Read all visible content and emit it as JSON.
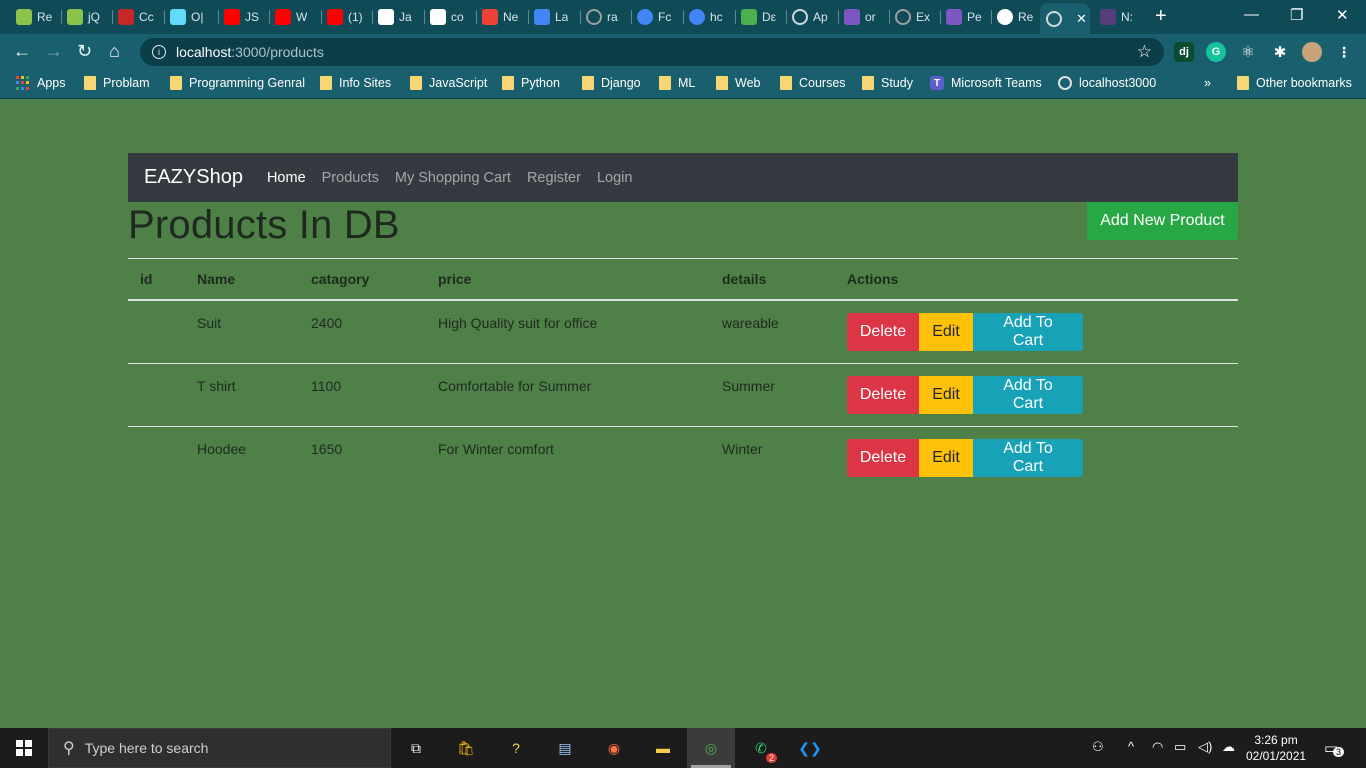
{
  "browser": {
    "tabs": [
      {
        "label": "Re",
        "icon": "green-chart-icon",
        "color": "#8bc34a"
      },
      {
        "label": "jQ",
        "icon": "green-chart-icon",
        "color": "#8bc34a"
      },
      {
        "label": "Cc",
        "icon": "red-figure-icon",
        "color": "#c62828"
      },
      {
        "label": "O|",
        "icon": "react-icon",
        "color": "#61dafb"
      },
      {
        "label": "JS",
        "icon": "youtube-icon",
        "color": "#ff0000"
      },
      {
        "label": "W",
        "icon": "youtube-icon",
        "color": "#ff0000"
      },
      {
        "label": "(1)",
        "icon": "youtube-icon",
        "color": "#ff0000"
      },
      {
        "label": "Ja",
        "icon": "bookmark-u-icon",
        "color": "#ffffff"
      },
      {
        "label": "co",
        "icon": "codepen-icon",
        "color": "#ffffff"
      },
      {
        "label": "Ne",
        "icon": "gmail-icon",
        "color": "#ea4335"
      },
      {
        "label": "La",
        "icon": "docs-icon",
        "color": "#4285f4"
      },
      {
        "label": "ra",
        "icon": "globe-icon",
        "color": "#9e9e9e"
      },
      {
        "label": "Fc",
        "icon": "google-icon",
        "color": "#4285f4"
      },
      {
        "label": "hc",
        "icon": "google-icon",
        "color": "#4285f4"
      },
      {
        "label": "Dε",
        "icon": "mongodb-leaf-icon",
        "color": "#4caf50"
      },
      {
        "label": "Ap",
        "icon": "globe-icon",
        "color": "#cfd8dc"
      },
      {
        "label": "or",
        "icon": "heroku-icon",
        "color": "#7e57c2"
      },
      {
        "label": "Ex",
        "icon": "globe-icon",
        "color": "#9e9e9e"
      },
      {
        "label": "Pe",
        "icon": "heroku-icon",
        "color": "#7e57c2"
      },
      {
        "label": "Re",
        "icon": "github-icon",
        "color": "#ffffff"
      },
      {
        "label": "",
        "icon": "globe-icon",
        "color": "#cfd8dc",
        "active": true
      },
      {
        "label": "N:",
        "icon": "bootstrap-icon",
        "color": "#563d7c"
      }
    ],
    "url_host": "localhost",
    "url_path": ":3000/products",
    "bookmarks": [
      {
        "label": "Apps",
        "icon": "apps-grid-icon"
      },
      {
        "label": "Problam",
        "icon": "folder-icon"
      },
      {
        "label": "Programming Genral",
        "icon": "folder-icon"
      },
      {
        "label": "Info Sites",
        "icon": "folder-icon"
      },
      {
        "label": "JavaScript",
        "icon": "folder-icon"
      },
      {
        "label": "Python",
        "icon": "folder-icon"
      },
      {
        "label": "Django",
        "icon": "folder-icon"
      },
      {
        "label": "ML",
        "icon": "folder-icon"
      },
      {
        "label": "Web",
        "icon": "folder-icon"
      },
      {
        "label": "Courses",
        "icon": "folder-icon"
      },
      {
        "label": "Study",
        "icon": "folder-icon"
      },
      {
        "label": "Microsoft Teams",
        "icon": "teams-icon"
      },
      {
        "label": "localhost3000",
        "icon": "globe-icon"
      },
      {
        "label": "»",
        "icon": "chevron-icon"
      },
      {
        "label": "Other bookmarks",
        "icon": "folder-icon"
      }
    ],
    "extensions": [
      {
        "label": "dj",
        "color": "#0c4b33"
      },
      {
        "label": "G",
        "color": "#15c39a"
      },
      {
        "label": "⚛",
        "color": "transparent"
      },
      {
        "label": "✱",
        "color": "transparent"
      }
    ]
  },
  "site": {
    "brand": "EAZYShop",
    "nav": [
      {
        "label": "Home",
        "active": true
      },
      {
        "label": "Products",
        "active": false
      },
      {
        "label": "My Shopping Cart",
        "active": false
      },
      {
        "label": "Register",
        "active": false
      },
      {
        "label": "Login",
        "active": false
      }
    ],
    "page_title": "Products In DB",
    "add_button": "Add New Product",
    "table": {
      "headers": [
        "id",
        "Name",
        "catagory",
        "price",
        "details",
        "Actions"
      ],
      "rows": [
        {
          "id": "",
          "name": "Suit",
          "catagory": "2400",
          "price": "High Quality suit for office",
          "details": "wareable"
        },
        {
          "id": "",
          "name": "T shirt",
          "catagory": "1100",
          "price": "Comfortable for Summer",
          "details": "Summer"
        },
        {
          "id": "",
          "name": "Hoodee",
          "catagory": "1650",
          "price": "For Winter comfort",
          "details": "Winter"
        }
      ],
      "actions": {
        "delete": "Delete",
        "edit": "Edit",
        "cart": "Add To Cart"
      }
    }
  },
  "taskbar": {
    "search_placeholder": "Type here to search",
    "time": "3:26 pm",
    "date": "02/01/2021",
    "notifications": "3",
    "whatsapp_badge": "2"
  },
  "colors": {
    "page_bg": "#4e8048",
    "navbar_bg": "#343a40",
    "success": "#28a745",
    "danger": "#dc3545",
    "warning": "#ffc107",
    "info": "#17a2b8"
  }
}
